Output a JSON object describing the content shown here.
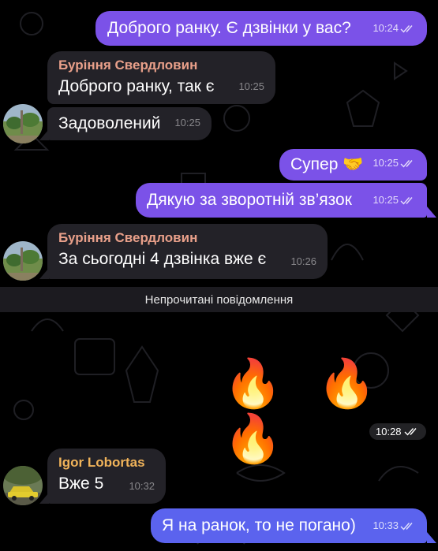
{
  "messages": [
    {
      "text": "Доброго ранку. Є дзвінки у вас?",
      "time": "10:24"
    },
    {
      "sender": "Буріння Свердловин",
      "text": "Доброго ранку, так є",
      "time": "10:25"
    },
    {
      "text": "Задоволений",
      "time": "10:25"
    },
    {
      "text": "Супер 🤝",
      "time": "10:25"
    },
    {
      "text": "Дякую за зворотній зв’язок",
      "time": "10:25"
    },
    {
      "sender": "Буріння Свердловин",
      "text": "За сьогодні 4 дзвінка вже є",
      "time": "10:26"
    },
    {
      "emoji": "🔥 🔥 🔥",
      "time": "10:28"
    },
    {
      "sender": "Igor Lobortas",
      "text": "Вже 5",
      "time": "10:32"
    },
    {
      "text": "Я на ранок, то не погано)",
      "time": "10:33"
    }
  ],
  "unread_divider": "Непрочитані повідомлення",
  "colors": {
    "background": "#000000",
    "outgoing_bubble": "#7b52e8",
    "outgoing_bubble_last": "#5b63ee",
    "incoming_bubble": "#232228",
    "sender_name_1": "#e9a08a",
    "sender_name_2": "#f0b35a"
  },
  "icons": [
    "double-check-icon",
    "avatar-photo"
  ]
}
